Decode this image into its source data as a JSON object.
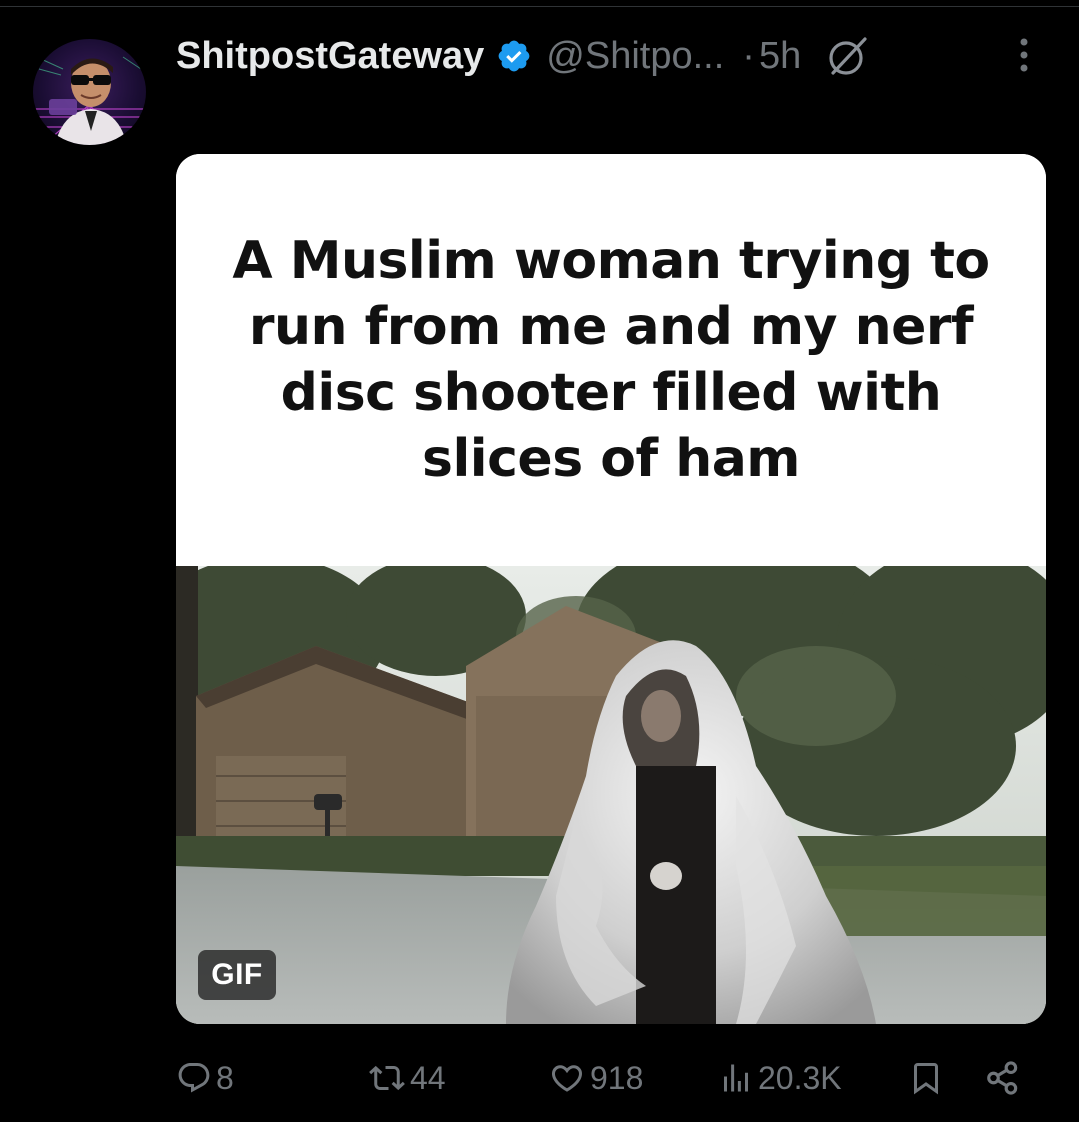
{
  "post": {
    "display_name": "ShitpostGateway",
    "handle": "@Shitpo...",
    "separator": "·",
    "time": "5h",
    "verified": true,
    "icons": {
      "verified": "verified-badge-icon",
      "grok": "grok-icon",
      "more": "more-vertical-icon"
    },
    "media": {
      "caption": "A Muslim woman trying to run from me and my nerf disc shooter filled with slices of ham",
      "badge": "GIF"
    },
    "actions": {
      "reply": {
        "icon": "reply-icon",
        "count": "8"
      },
      "repost": {
        "icon": "repost-icon",
        "count": "44"
      },
      "like": {
        "icon": "heart-icon",
        "count": "918"
      },
      "views": {
        "icon": "views-icon",
        "count": "20.3K"
      },
      "bookmark": {
        "icon": "bookmark-icon"
      },
      "share": {
        "icon": "share-icon"
      }
    }
  },
  "colors": {
    "background": "#000000",
    "text_primary": "#e7e9ea",
    "text_secondary": "#71767b",
    "verified_blue": "#1d9bf0"
  }
}
